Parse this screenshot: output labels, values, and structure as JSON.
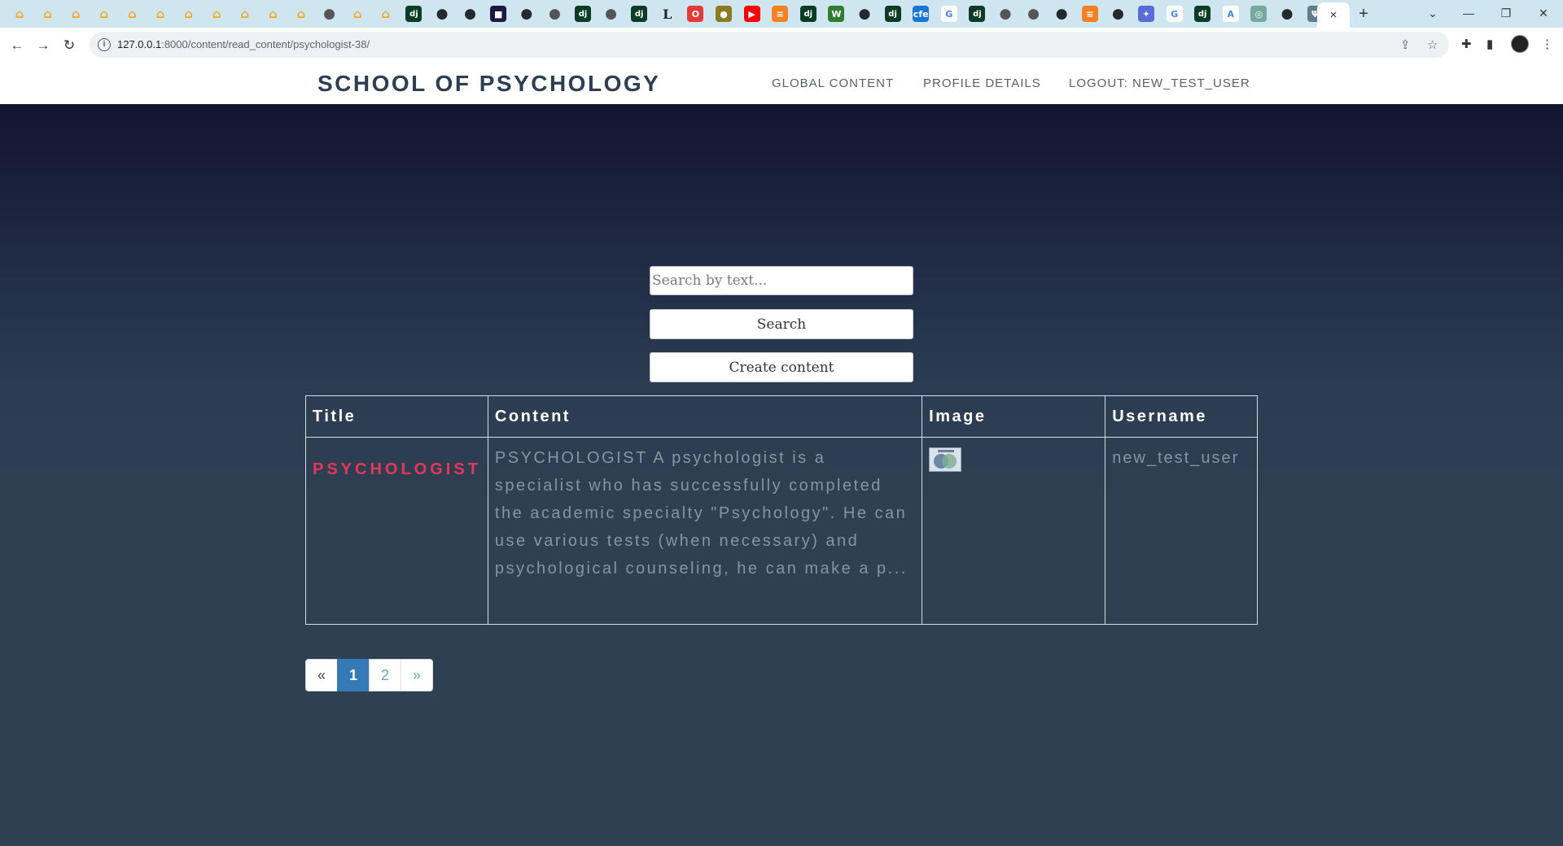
{
  "browser": {
    "url_host": "127.0.0.1",
    "url_rest": ":8000/content/read_content/psychologist-38/",
    "active_tab_close": "×",
    "new_tab": "+",
    "favicons": [
      {
        "icon": "school-cap-icon",
        "color": "#f2a92b",
        "glyph": "⌂"
      },
      {
        "icon": "school-cap-icon",
        "color": "#f2a92b",
        "glyph": "⌂"
      },
      {
        "icon": "school-cap-icon",
        "color": "#f2a92b",
        "glyph": "⌂"
      },
      {
        "icon": "school-cap-icon",
        "color": "#f2a92b",
        "glyph": "⌂"
      },
      {
        "icon": "school-cap-icon",
        "color": "#f2a92b",
        "glyph": "⌂"
      },
      {
        "icon": "school-cap-icon",
        "color": "#f2a92b",
        "glyph": "⌂"
      },
      {
        "icon": "school-cap-icon",
        "color": "#f2a92b",
        "glyph": "⌂"
      },
      {
        "icon": "school-cap-icon",
        "color": "#f2a92b",
        "glyph": "⌂"
      },
      {
        "icon": "school-cap-icon",
        "color": "#f2a92b",
        "glyph": "⌂"
      },
      {
        "icon": "school-cap-icon",
        "color": "#f2a92b",
        "glyph": "⌂"
      },
      {
        "icon": "school-cap-icon",
        "color": "#f2a92b",
        "glyph": "⌂"
      },
      {
        "icon": "globe-icon",
        "color": "#555555",
        "glyph": "●"
      },
      {
        "icon": "school-cap-icon",
        "color": "#f2a92b",
        "glyph": "⌂"
      },
      {
        "icon": "school-cap-icon",
        "color": "#f2a92b",
        "glyph": "⌂"
      },
      {
        "icon": "django-icon",
        "color": "#0c3c26",
        "glyph": "dj"
      },
      {
        "icon": "github-icon",
        "color": "#24292e",
        "glyph": "●"
      },
      {
        "icon": "github-icon",
        "color": "#24292e",
        "glyph": "●"
      },
      {
        "icon": "app-icon",
        "color": "#1a1a40",
        "glyph": "■"
      },
      {
        "icon": "github-icon",
        "color": "#24292e",
        "glyph": "●"
      },
      {
        "icon": "globe-icon",
        "color": "#555555",
        "glyph": "●"
      },
      {
        "icon": "django-icon",
        "color": "#0c3c26",
        "glyph": "dj"
      },
      {
        "icon": "globe-icon",
        "color": "#555555",
        "glyph": "●"
      },
      {
        "icon": "django-icon",
        "color": "#0c3c26",
        "glyph": "dj"
      },
      {
        "icon": "l-icon",
        "color": "#ffffff",
        "glyph": "L"
      },
      {
        "icon": "opera-icon",
        "color": "#e53935",
        "glyph": "O"
      },
      {
        "icon": "coin-icon",
        "color": "#8a7a20",
        "glyph": "●"
      },
      {
        "icon": "youtube-icon",
        "color": "#ff0000",
        "glyph": "▶"
      },
      {
        "icon": "stackoverflow-icon",
        "color": "#f48024",
        "glyph": "≡"
      },
      {
        "icon": "django-icon",
        "color": "#0c3c26",
        "glyph": "dj"
      },
      {
        "icon": "w-icon",
        "color": "#2e7d32",
        "glyph": "W"
      },
      {
        "icon": "github-icon",
        "color": "#24292e",
        "glyph": "●"
      },
      {
        "icon": "django-icon",
        "color": "#0c3c26",
        "glyph": "dj"
      },
      {
        "icon": "cfe-icon",
        "color": "#1976d2",
        "glyph": "cfe"
      },
      {
        "icon": "google-icon",
        "color": "#4285f4",
        "glyph": "G"
      },
      {
        "icon": "django-icon",
        "color": "#0c3c26",
        "glyph": "dj"
      },
      {
        "icon": "globe-icon",
        "color": "#555555",
        "glyph": "●"
      },
      {
        "icon": "globe-icon",
        "color": "#555555",
        "glyph": "●"
      },
      {
        "icon": "github-icon",
        "color": "#24292e",
        "glyph": "●"
      },
      {
        "icon": "stackoverflow-icon",
        "color": "#f48024",
        "glyph": "≡"
      },
      {
        "icon": "github-icon",
        "color": "#24292e",
        "glyph": "●"
      },
      {
        "icon": "sparkle-icon",
        "color": "#5b6bd6",
        "glyph": "✦"
      },
      {
        "icon": "google-icon",
        "color": "#4285f4",
        "glyph": "G"
      },
      {
        "icon": "django-icon",
        "color": "#0c3c26",
        "glyph": "dj"
      },
      {
        "icon": "translate-icon",
        "color": "#4285f4",
        "glyph": "A"
      },
      {
        "icon": "chatgpt-icon",
        "color": "#74aa9c",
        "glyph": "◎"
      },
      {
        "icon": "github-icon",
        "color": "#24292e",
        "glyph": "●"
      },
      {
        "icon": "psi-icon",
        "color": "#607d8b",
        "glyph": "Ψ"
      }
    ]
  },
  "header": {
    "brand": "SCHOOL OF PSYCHOLOGY",
    "nav": [
      "GLOBAL CONTENT",
      "PROFILE DETAILS",
      "LOGOUT: NEW_TEST_USER"
    ]
  },
  "search": {
    "placeholder": "Search by text...",
    "value": "",
    "button_label": "Search",
    "create_label": "Create content"
  },
  "table": {
    "headers": [
      "Title",
      "Content",
      "Image",
      "Username"
    ],
    "rows": [
      {
        "title": "PSYCHOLOGIST",
        "content": "PSYCHOLOGIST A psychologist is a specialist who has successfully completed the academic specialty \"Psychology\". He can use various tests (when necessary) and psychological counseling, he can make a p...",
        "image": "thumbnail",
        "username": "new_test_user"
      }
    ]
  },
  "pagination": {
    "prev": "«",
    "pages": [
      "1",
      "2"
    ],
    "active_page": "1",
    "next": "»"
  },
  "colors": {
    "brand_text": "#2c3e50",
    "title_accent": "#e8365b",
    "page_active": "#337ab7",
    "background": "#2f4052"
  }
}
